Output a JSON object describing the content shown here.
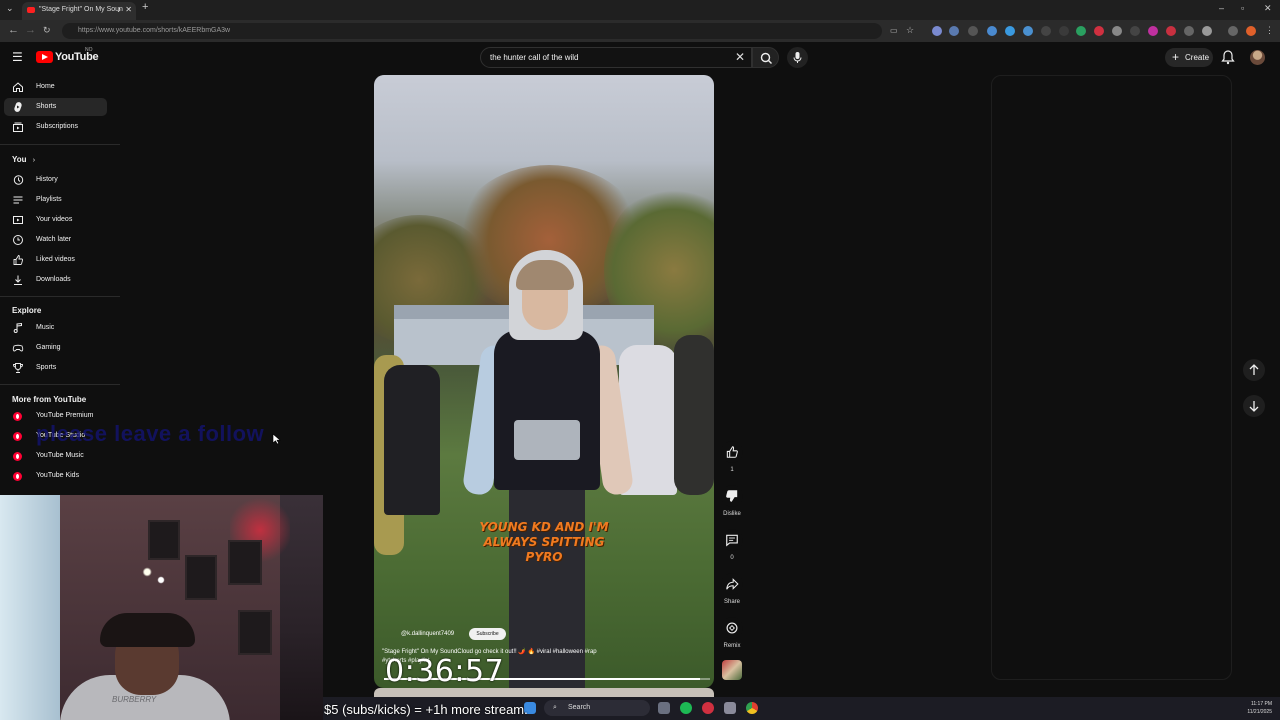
{
  "browser": {
    "tab_title": "\"Stage Fright\" On My Soun",
    "url": "https://www.youtube.com/shorts/kAEERbmGA3w"
  },
  "youtube": {
    "logo_text": "YouTube",
    "logo_country": "NO",
    "search_value": "the hunter call of the wild",
    "create_label": "Create"
  },
  "sidebar": {
    "main": [
      {
        "label": "Home",
        "icon": "home-icon"
      },
      {
        "label": "Shorts",
        "icon": "shorts-icon",
        "active": true
      },
      {
        "label": "Subscriptions",
        "icon": "subscriptions-icon"
      }
    ],
    "you_heading": "You",
    "you_items": [
      {
        "label": "History",
        "icon": "history-icon"
      },
      {
        "label": "Playlists",
        "icon": "playlists-icon"
      },
      {
        "label": "Your videos",
        "icon": "your-videos-icon"
      },
      {
        "label": "Watch later",
        "icon": "watch-later-icon"
      },
      {
        "label": "Liked videos",
        "icon": "liked-videos-icon"
      },
      {
        "label": "Downloads",
        "icon": "downloads-icon"
      }
    ],
    "explore_heading": "Explore",
    "explore_items": [
      {
        "label": "Music",
        "icon": "music-icon"
      },
      {
        "label": "Gaming",
        "icon": "gaming-icon"
      },
      {
        "label": "Sports",
        "icon": "sports-icon"
      }
    ],
    "more_heading": "More from YouTube",
    "more_items": [
      {
        "label": "YouTube Premium"
      },
      {
        "label": "YouTube Studio"
      },
      {
        "label": "YouTube Music"
      },
      {
        "label": "YouTube Kids"
      }
    ]
  },
  "short": {
    "caption": "YOUNG KD AND I'M ALWAYS SPITTING PYRO",
    "channel": "@k.dallinquent7409",
    "subscribe_label": "Subscribe",
    "description": "\"Stage Fright\" On My SoundCloud go check it out!! 🌶️ 🔥 #viral #halloween #rap #ytshorts #playlist",
    "progress": 0.97
  },
  "actions": {
    "likes": "1",
    "dislike_label": "Dislike",
    "comments": "0",
    "share_label": "Share",
    "remix_label": "Remix"
  },
  "overlays": {
    "follow_text": "please leave a follow",
    "timer": "0:36:57",
    "stream_text": "$5 (subs/kicks) = +1h more stream."
  },
  "webcam": {
    "shirt_text": "BURBERRY"
  },
  "taskbar": {
    "search_placeholder": "Search",
    "time": "11:17 PM",
    "date": "11/21/2025"
  },
  "colors": {
    "brand_red": "#ff0000",
    "background": "#0f0f0f",
    "caption_orange": "#f07a20"
  }
}
